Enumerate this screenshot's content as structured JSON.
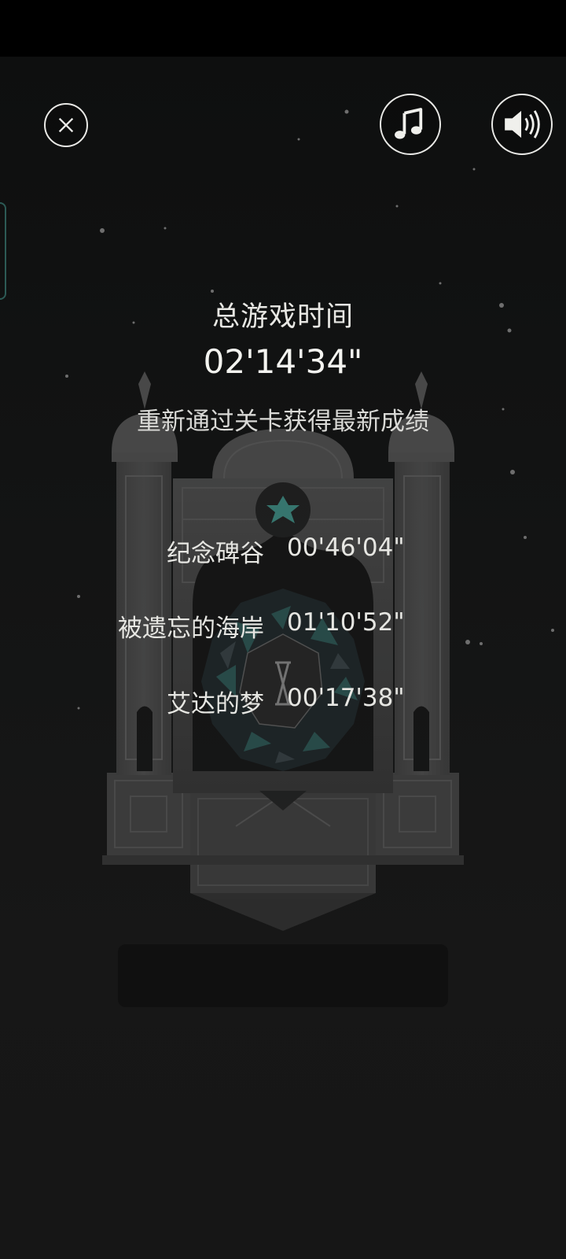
{
  "controls": {
    "close_icon": "close-icon",
    "music_icon": "music-note-icon",
    "sound_icon": "speaker-icon"
  },
  "summary": {
    "title": "总游戏时间",
    "total_time": "02'14'34\"",
    "hint": "重新通过关卡获得最新成绩"
  },
  "levels": [
    {
      "name": "纪念碑谷",
      "time": "00'46'04\""
    },
    {
      "name": "被遗忘的海岸",
      "time": "01'10'52\""
    },
    {
      "name": "艾达的梦",
      "time": "00'17'38\""
    }
  ],
  "colors": {
    "background": "#131414",
    "text": "#e8e8e4",
    "tower": "#3a3a3a",
    "accent_teal": "#3f8f86",
    "side_tab_border": "#2c5a55"
  }
}
